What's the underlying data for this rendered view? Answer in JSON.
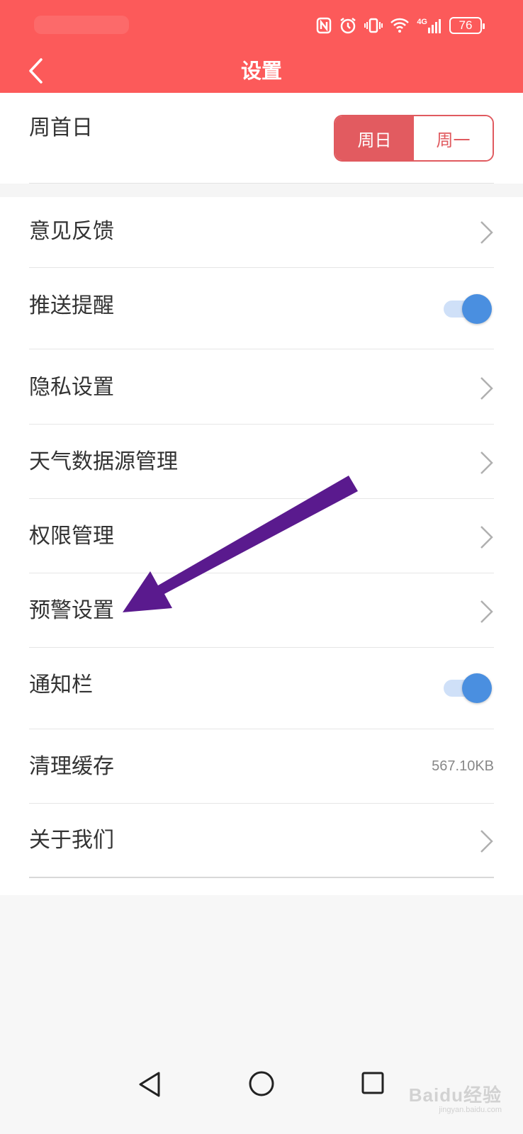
{
  "status_bar": {
    "network_label": "4G",
    "battery": "76"
  },
  "header": {
    "title": "设置",
    "back_icon": "chevron-left-icon",
    "background_color": "#fc5a5a"
  },
  "week_start": {
    "label": "周首日",
    "options": [
      "周日",
      "周一"
    ],
    "selected": "周日",
    "accent_color": "#e25b60"
  },
  "settings": {
    "feedback": "意见反馈",
    "push": "推送提醒",
    "privacy": "隐私设置",
    "weather_source": "天气数据源管理",
    "permissions": "权限管理",
    "warning": "预警设置",
    "notification_bar": "通知栏",
    "clear_cache": "清理缓存",
    "cache_size": "567.10KB",
    "about": "关于我们"
  },
  "toggles": {
    "push_enabled": true,
    "notification_bar_enabled": true,
    "on_color": "#4a8fe0"
  },
  "annotation": {
    "arrow_color": "#5a1a8e"
  },
  "watermark": {
    "main": "Baidu经验",
    "sub": "jingyan.baidu.com"
  }
}
